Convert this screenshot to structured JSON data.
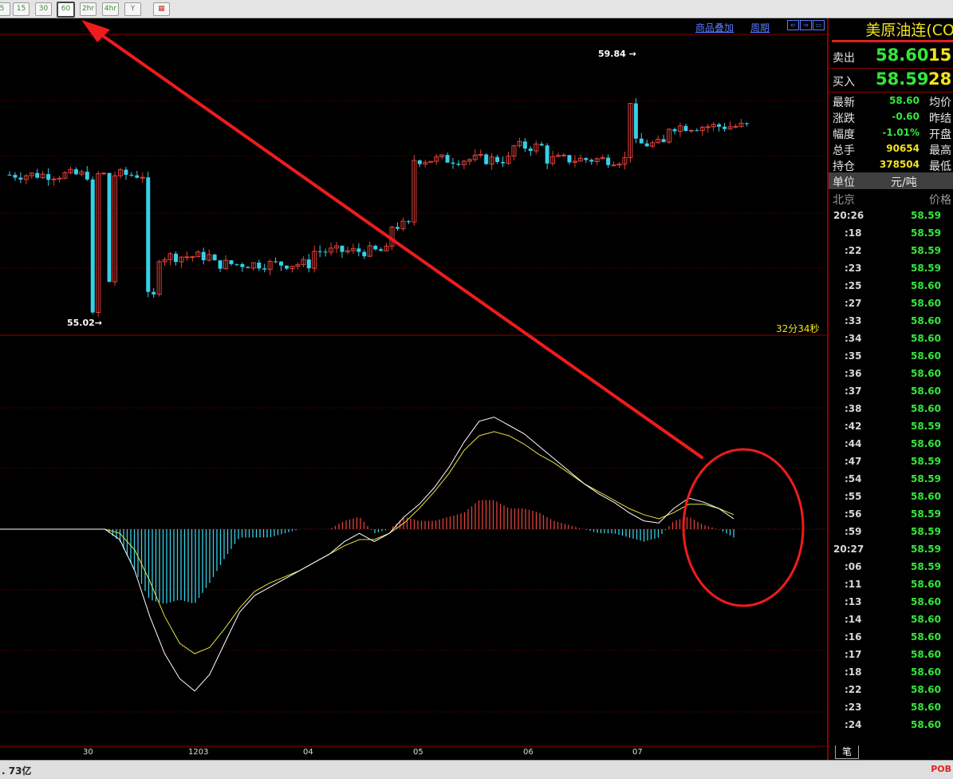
{
  "toolbar": {
    "buttons": [
      {
        "label": "5",
        "icon": "",
        "active": false
      },
      {
        "label": "15",
        "icon": "",
        "active": false
      },
      {
        "label": "30",
        "icon": "",
        "active": false
      },
      {
        "label": "60",
        "icon": "",
        "active": true
      },
      {
        "label": "2hr",
        "icon": "",
        "active": false
      },
      {
        "label": "4hr",
        "icon": "",
        "active": false
      },
      {
        "label": "Y",
        "icon": "",
        "active": false
      },
      {
        "label": "",
        "icon": "calendar-icon",
        "active": false
      }
    ]
  },
  "chart": {
    "overlay_link": "商品叠加",
    "period_link": "周期",
    "high_label": "59.84",
    "low_label": "55.02",
    "countdown": "32分34秒",
    "x_labels": [
      "30",
      "1203",
      "04",
      "05",
      "06",
      "07"
    ]
  },
  "quote": {
    "title": "美原油连(CO",
    "sell_label": "卖出",
    "sell_price": "58.60",
    "sell_volume": "15",
    "buy_label": "买入",
    "buy_price": "58.59",
    "buy_volume": "28",
    "stats": [
      {
        "label": "最新",
        "value": "58.60",
        "right_label": "均价",
        "color": "#34e83a"
      },
      {
        "label": "涨跌",
        "value": "-0.60",
        "right_label": "昨结",
        "color": "#34e83a"
      },
      {
        "label": "幅度",
        "value": "-1.01%",
        "right_label": "开盘",
        "color": "#34e83a"
      },
      {
        "label": "总手",
        "value": "90654",
        "right_label": "最高",
        "color": "#f2e21d"
      },
      {
        "label": "持仓",
        "value": "378504",
        "right_label": "最低",
        "color": "#f2e21d"
      }
    ],
    "unit_label": "单位",
    "unit_value": "元/吨",
    "tick_header_left": "北京",
    "tick_header_right": "价格",
    "ticks": [
      {
        "time": "20:26",
        "price": "58.59"
      },
      {
        "time": ":18",
        "price": "58.59"
      },
      {
        "time": ":22",
        "price": "58.59"
      },
      {
        "time": ":23",
        "price": "58.59"
      },
      {
        "time": ":25",
        "price": "58.60"
      },
      {
        "time": ":27",
        "price": "58.60"
      },
      {
        "time": ":33",
        "price": "58.60"
      },
      {
        "time": ":34",
        "price": "58.60"
      },
      {
        "time": ":35",
        "price": "58.60"
      },
      {
        "time": ":36",
        "price": "58.60"
      },
      {
        "time": ":37",
        "price": "58.60"
      },
      {
        "time": ":38",
        "price": "58.60"
      },
      {
        "time": ":42",
        "price": "58.59"
      },
      {
        "time": ":44",
        "price": "58.60"
      },
      {
        "time": ":47",
        "price": "58.59"
      },
      {
        "time": ":54",
        "price": "58.59"
      },
      {
        "time": ":55",
        "price": "58.60"
      },
      {
        "time": ":56",
        "price": "58.59"
      },
      {
        "time": ":59",
        "price": "58.59"
      },
      {
        "time": "20:27",
        "price": "58.59"
      },
      {
        "time": ":06",
        "price": "58.59"
      },
      {
        "time": ":11",
        "price": "58.60"
      },
      {
        "time": ":13",
        "price": "58.60"
      },
      {
        "time": ":14",
        "price": "58.60"
      },
      {
        "time": ":16",
        "price": "58.60"
      },
      {
        "time": ":17",
        "price": "58.60"
      },
      {
        "time": ":18",
        "price": "58.60"
      },
      {
        "time": ":22",
        "price": "58.60"
      },
      {
        "time": ":23",
        "price": "58.60"
      },
      {
        "time": ":24",
        "price": "58.60"
      }
    ],
    "tab_label": "笔"
  },
  "status": {
    "left": ". 73亿",
    "right": "POB"
  },
  "colors": {
    "up": "#e0403a",
    "down": "#35d0e8",
    "grid": "#8b0000",
    "macd_dif": "#ffffff",
    "macd_dea": "#e8e040",
    "annotation": "#ee1c1c"
  },
  "chart_data": {
    "type": "candlestick",
    "price_high": 59.84,
    "price_low": 55.02,
    "segments": [
      {
        "from": 0,
        "to": 24,
        "v": 57.9
      },
      {
        "from": 25,
        "to": 26,
        "v": 55.5
      },
      {
        "from": 27,
        "to": 36,
        "v": 56.3
      },
      {
        "from": 37,
        "to": 54,
        "v": 56.15
      },
      {
        "from": 55,
        "to": 68,
        "v": 56.4
      },
      {
        "from": 69,
        "to": 72,
        "v": 56.9
      },
      {
        "from": 73,
        "to": 90,
        "v": 58.2
      },
      {
        "from": 91,
        "to": 96,
        "v": 58.45
      },
      {
        "from": 97,
        "to": 112,
        "v": 58.2
      },
      {
        "from": 113,
        "to": 118,
        "v": 58.5
      },
      {
        "from": 119,
        "to": 133,
        "v": 58.85
      }
    ],
    "macd_dif": [
      0,
      0,
      0,
      0,
      0,
      0,
      0,
      0,
      -0.05,
      -0.2,
      -0.42,
      -0.6,
      -0.72,
      -0.78,
      -0.7,
      -0.55,
      -0.4,
      -0.32,
      -0.28,
      -0.24,
      -0.2,
      -0.16,
      -0.12,
      -0.06,
      -0.02,
      -0.06,
      -0.02,
      0.06,
      0.12,
      0.2,
      0.3,
      0.42,
      0.52,
      0.54,
      0.5,
      0.46,
      0.4,
      0.34,
      0.28,
      0.22,
      0.17,
      0.13,
      0.08,
      0.04,
      0.03,
      0.1,
      0.15,
      0.13,
      0.1,
      0.05
    ],
    "macd_dea": [
      0,
      0,
      0,
      0,
      0,
      0,
      0,
      0,
      -0.02,
      -0.1,
      -0.25,
      -0.42,
      -0.55,
      -0.6,
      -0.57,
      -0.48,
      -0.38,
      -0.3,
      -0.26,
      -0.23,
      -0.2,
      -0.16,
      -0.12,
      -0.08,
      -0.05,
      -0.05,
      -0.02,
      0.03,
      0.1,
      0.18,
      0.27,
      0.38,
      0.45,
      0.47,
      0.45,
      0.41,
      0.36,
      0.32,
      0.27,
      0.22,
      0.18,
      0.14,
      0.1,
      0.07,
      0.05,
      0.08,
      0.12,
      0.12,
      0.1,
      0.07
    ]
  }
}
